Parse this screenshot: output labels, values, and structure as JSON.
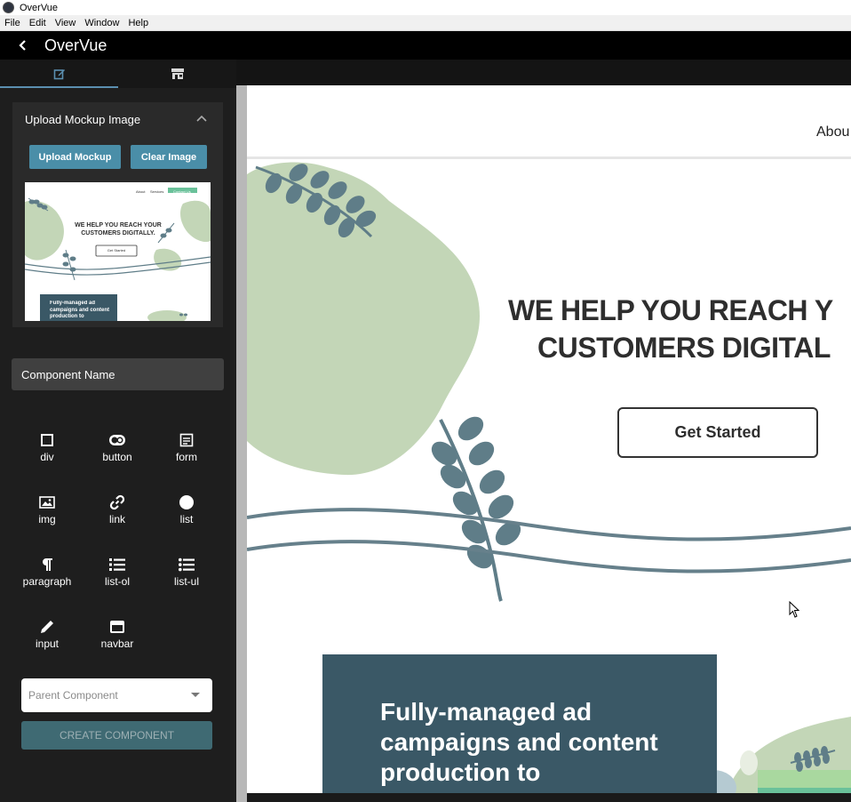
{
  "os": {
    "title": "OverVue",
    "menu": [
      "File",
      "Edit",
      "View",
      "Window",
      "Help"
    ]
  },
  "header": {
    "title": "OverVue"
  },
  "tabs": [
    {
      "icon": "edit-icon"
    },
    {
      "icon": "store-icon"
    }
  ],
  "upload": {
    "title": "Upload Mockup Image",
    "upload_label": "Upload Mockup",
    "clear_label": "Clear Image"
  },
  "thumb": {
    "nav": [
      "About",
      "Services",
      "Contact Us"
    ],
    "headline": "WE HELP YOU REACH YOUR CUSTOMERS DIGITALLY.",
    "button": "Get Started",
    "card": "Fully-managed ad campaigns and content production to"
  },
  "component_name": {
    "placeholder": "Component Name"
  },
  "elements": [
    {
      "label": "div",
      "icon": "square-icon"
    },
    {
      "label": "button",
      "icon": "toggle-icon"
    },
    {
      "label": "form",
      "icon": "form-icon"
    },
    {
      "label": "img",
      "icon": "image-icon"
    },
    {
      "label": "link",
      "icon": "link-icon"
    },
    {
      "label": "list",
      "icon": "circle-icon"
    },
    {
      "label": "paragraph",
      "icon": "paragraph-icon"
    },
    {
      "label": "list-ol",
      "icon": "list-ol-icon"
    },
    {
      "label": "list-ul",
      "icon": "list-ul-icon"
    },
    {
      "label": "input",
      "icon": "pencil-icon"
    },
    {
      "label": "navbar",
      "icon": "navbar-icon"
    }
  ],
  "parent_select": {
    "placeholder": "Parent Component"
  },
  "create_button": {
    "label": "CREATE COMPONENT"
  },
  "canvas": {
    "nav_link": "Abou",
    "headline_1": "WE HELP YOU REACH Y",
    "headline_2": "CUSTOMERS DIGITAL",
    "cta": "Get Started",
    "card_text": "Fully-managed ad campaigns and content production to"
  },
  "colors": {
    "accent": "#4a8ea8",
    "leaf": "#5f7d88",
    "blob": "#c3d6b7",
    "card": "#3a5866"
  }
}
